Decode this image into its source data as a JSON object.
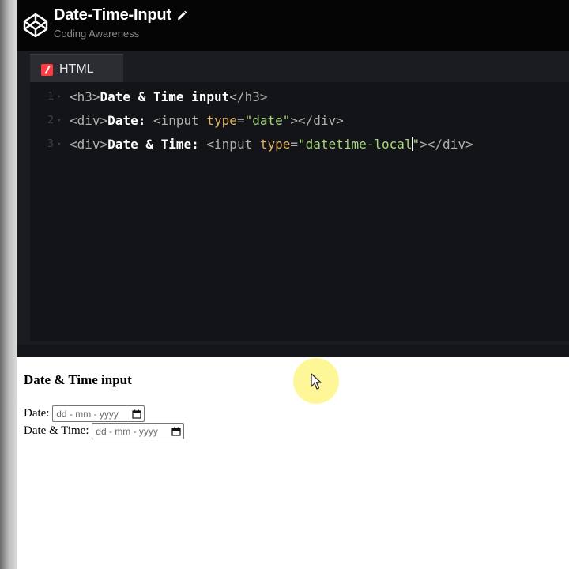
{
  "header": {
    "pen_title": "Date-Time-Input",
    "author": "Coding Awareness",
    "logo_icon": "codepen-logo-icon",
    "edit_icon": "pencil-icon"
  },
  "editor": {
    "tab_label": "HTML",
    "tab_icon": "html-badge-icon",
    "lines": [
      {
        "number": "1",
        "tokens": [
          {
            "type": "tag",
            "text": "<h3>"
          },
          {
            "type": "text",
            "text": "Date & Time input"
          },
          {
            "type": "tag",
            "text": "</h3>"
          }
        ]
      },
      {
        "number": "2",
        "tokens": [
          {
            "type": "tag",
            "text": "<div>"
          },
          {
            "type": "text",
            "text": "Date: "
          },
          {
            "type": "tag",
            "text": "<input "
          },
          {
            "type": "attr",
            "text": "type"
          },
          {
            "type": "tag",
            "text": "="
          },
          {
            "type": "str",
            "text": "\"date\""
          },
          {
            "type": "tag",
            "text": "></div>"
          }
        ]
      },
      {
        "number": "3",
        "tokens": [
          {
            "type": "tag",
            "text": "<div>"
          },
          {
            "type": "text",
            "text": "Date & Time: "
          },
          {
            "type": "tag",
            "text": "<input "
          },
          {
            "type": "attr",
            "text": "type"
          },
          {
            "type": "tag",
            "text": "="
          },
          {
            "type": "str",
            "text": "\"datetime-local"
          },
          {
            "type": "caret",
            "text": ""
          },
          {
            "type": "str",
            "text": "\""
          },
          {
            "type": "tag",
            "text": "></div>"
          }
        ]
      }
    ]
  },
  "preview": {
    "heading": "Date & Time input",
    "date_label": "Date:",
    "date_placeholder": "dd - mm - yyyy",
    "datetime_label": "Date & Time:",
    "datetime_placeholder": "dd - mm - yyyy",
    "calendar_icon": "calendar-icon"
  },
  "colors": {
    "tag": "#b0b0b0",
    "attr": "#e0b15f",
    "string": "#a7d67a",
    "text": "#ffffff",
    "html_badge": "#ff3c41",
    "cursor_highlight": "#fff68c"
  }
}
